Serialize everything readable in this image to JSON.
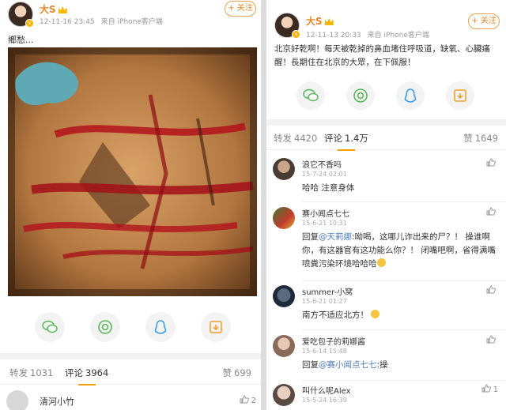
{
  "left_post": {
    "username": "大S",
    "timestamp": "12-11-16 23:45",
    "source": "来自 iPhone客户端",
    "follow_label": "+ 关注",
    "text": "鄉愁...",
    "tabs": {
      "repost_label": "转发",
      "repost_count": "1031",
      "comment_label": "评论",
      "comment_count": "3964",
      "like_label": "赞",
      "like_count": "699"
    },
    "comment": {
      "name": "清河小竹",
      "likes": "2"
    }
  },
  "right_post": {
    "username": "大S",
    "timestamp": "12-11-13 20:33",
    "source": "来自 iPhone客户端",
    "follow_label": "+ 关注",
    "text": "北京好乾啊！每天被乾掉的鼻血堵住呼吸道，缺氧、心臟痛醒！長期住在北京的大眾，在下佩服！",
    "tabs": {
      "repost_label": "转发",
      "repost_count": "4420",
      "comment_label": "评论",
      "comment_count": "1.4万",
      "like_label": "赞",
      "like_count": "1649"
    },
    "comments": [
      {
        "name": "浪它不香吗",
        "time": "15-7-24 02:01",
        "text": "哈哈 注意身体",
        "likes": ""
      },
      {
        "name": "赛小闻点七七",
        "time": "15-6-21 10:31",
        "reply_prefix": "回复",
        "mention": "@天莉娜",
        "text": ":呦喝，这哪儿诈出来的尸？！ 操谁啊你，有这器官有这功能么你？！ 闭嘴吧啊，省得满嘴喷粪污染环境哈哈哈",
        "likes": ""
      },
      {
        "name": "summer-小窝",
        "time": "15-6-21 01:27",
        "text": "南方不适应北方！",
        "likes": ""
      },
      {
        "name": "爱吃包子的莉娜酱",
        "time": "15-6-14 15:48",
        "reply_prefix": "回复",
        "mention": "@赛小闻点七七",
        "text": ":操",
        "likes": ""
      },
      {
        "name": "叫什么呢Alex",
        "time": "15-5-24 16:39",
        "text": "",
        "likes": "1"
      }
    ]
  },
  "colors": {
    "accent": "#f7a000",
    "username": "#e8862a",
    "link": "#4a7fc1"
  },
  "share_icons": [
    "wechat-icon",
    "moments-icon",
    "qq-icon",
    "save-image-icon"
  ]
}
